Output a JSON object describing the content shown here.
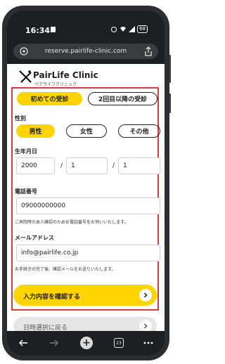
{
  "status": {
    "time": "16:34",
    "battery": "68"
  },
  "browser": {
    "url": "reserve.pairlife-clinic.com",
    "tabs_count": "23"
  },
  "logo": {
    "name": "PairLife Clinic",
    "sub": "ペアライフクリニック"
  },
  "form": {
    "visit_tabs": [
      "初めての受診",
      "2回目以降の受診"
    ],
    "gender_label": "性別",
    "genders": [
      "男性",
      "女性",
      "その他"
    ],
    "dob_label": "生年月日",
    "dob": {
      "year": "2000",
      "month": "1",
      "day": "1",
      "sep": "/"
    },
    "phone_label": "電話番号",
    "phone_value": "09000000000",
    "phone_note": "ご来院時の本人確認のためお電話番号をお伺いいたします。",
    "email_label": "メールアドレス",
    "email_value": "info@pairlife.co.jp",
    "email_note": "お手続きの完了後、確認メールをお送りいたします。",
    "submit": "入力内容を確認する",
    "back": "日時選択に戻る"
  },
  "icons": [
    "site-settings-icon",
    "share-icon",
    "back-arrow-icon",
    "forward-arrow-icon",
    "new-tab-icon",
    "tabs-icon",
    "more-icon",
    "chevron-right-icon"
  ]
}
